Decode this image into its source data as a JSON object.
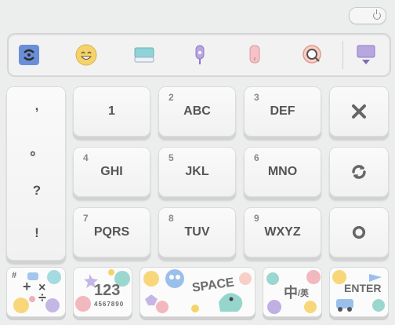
{
  "toolbar": {
    "icons": [
      "swype-logo-icon",
      "emoji-icon",
      "keyboard-icon",
      "microphone-icon",
      "usb-icon",
      "search-icon",
      "hide-keyboard-icon"
    ]
  },
  "punctuation": [
    ",",
    "。",
    "?",
    "!"
  ],
  "keys": [
    {
      "digit": "",
      "label": "1"
    },
    {
      "digit": "2",
      "label": "ABC"
    },
    {
      "digit": "3",
      "label": "DEF"
    },
    {
      "digit": "4",
      "label": "GHI"
    },
    {
      "digit": "5",
      "label": "JKL"
    },
    {
      "digit": "6",
      "label": "MNO"
    },
    {
      "digit": "7",
      "label": "PQRS"
    },
    {
      "digit": "8",
      "label": "TUV"
    },
    {
      "digit": "9",
      "label": "WXYZ"
    }
  ],
  "side_keys": [
    "delete-icon",
    "refresh-icon",
    "reset-icon"
  ],
  "bottom": {
    "symbols_label": "#",
    "numbers_label": "123",
    "numbers_sub": "4567890",
    "space_label": "SPACE",
    "lang_main": "中",
    "lang_sub": "/英",
    "enter_label": "ENTER"
  },
  "colors": {
    "background": "#eceded",
    "key_text": "#555555",
    "accent_blue": "#6a8fd8",
    "accent_yellow": "#f6d36a",
    "accent_pink": "#f1b0b7",
    "accent_teal": "#8fd3c9",
    "accent_purple": "#b8a6e0"
  }
}
